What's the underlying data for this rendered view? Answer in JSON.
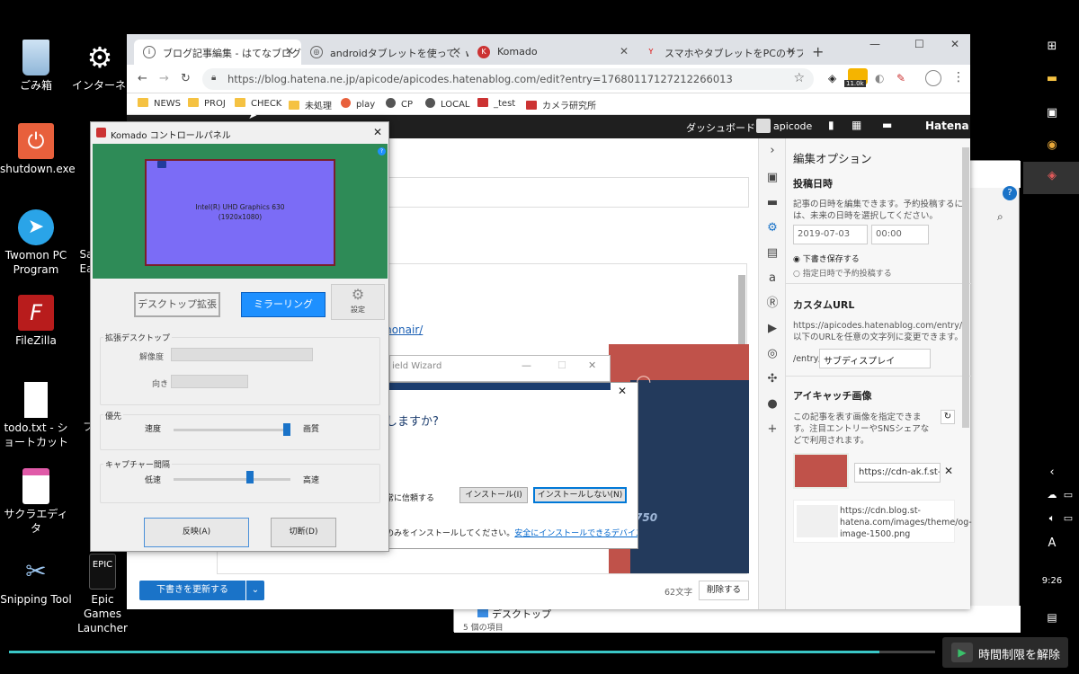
{
  "desktop": {
    "icons": [
      {
        "label": "ごみ箱",
        "name": "recycle-bin"
      },
      {
        "label": "インターネットショートカット",
        "name": "internet-shortcut"
      },
      {
        "label": "shutdown.exe",
        "name": "shutdown"
      },
      {
        "label": "Twomon PC Program",
        "name": "twomon"
      },
      {
        "label": "Sa Ea",
        "name": "sa"
      },
      {
        "label": "FileZilla",
        "name": "filezilla"
      },
      {
        "label": "todo.txt - ショートカット",
        "name": "todo"
      },
      {
        "label": "フ",
        "name": "fu"
      },
      {
        "label": "サクラエディタ",
        "name": "sakura"
      },
      {
        "label": "Snipping Tool",
        "name": "snipping"
      },
      {
        "label": "Epic Games Launcher",
        "name": "epic"
      }
    ]
  },
  "chrome": {
    "tabs": [
      {
        "title": "ブログ記事編集 - はてなブログ",
        "fav": "i"
      },
      {
        "title": "androidタブレットを使って、windows",
        "fav": "◎"
      },
      {
        "title": "Komado",
        "fav": "K"
      },
      {
        "title": "スマホやタブレットをPCのサブディスプレ",
        "fav": "Y"
      }
    ],
    "url": "https://blog.hatena.ne.jp/apicode/apicodes.hatenablog.com/edit?entry=17680117127212266013",
    "ext_badge": "11.0k",
    "bookmarks": [
      "NEWS",
      "PROJ",
      "CHECK",
      "未処理",
      "play",
      "CP",
      "LOCAL",
      "_test",
      "カメラ研究所"
    ]
  },
  "hatena": {
    "dashboard": "ダッシュボード",
    "user": "apicode",
    "brand": "Hatena",
    "link_text": "monair/",
    "update_button": "下書きを更新する",
    "char_count": "62文字",
    "delete_button": "削除する",
    "badge_750": "750"
  },
  "options": {
    "title": "編集オプション",
    "post_date_h": "投稿日時",
    "post_date_t": "記事の日時を編集できます。予約投稿するには、未来の日時を選択してください。",
    "date": "2019-07-03",
    "time": "00:00",
    "radio_draft": "下書き保存する",
    "radio_schedule": "指定日時で予約投稿する",
    "custom_url_h": "カスタムURL",
    "custom_url_t": "https://apicodes.hatenablog.com/entry/以下のURLを任意の文字列に変更できます。",
    "entry_prefix": "/entry/",
    "entry_value": "サブディスプレイ",
    "eyecatch_h": "アイキャッチ画像",
    "eyecatch_t": "この記事を表す画像を指定できます。注目エントリーやSNSシェアなどで利用されます。",
    "eyecatch_url": "https://cdn-ak.f.st-hat",
    "og_url": "https://cdn.blog.st-hatena.com/images/theme/og-image-1500.png"
  },
  "komado": {
    "title": "Komado コントロールパネル",
    "gpu_line1": "Intel(R) UHD Graphics 630",
    "gpu_line2": "(1920x1080)",
    "btn_extend": "デスクトップ拡張",
    "btn_mirror": "ミラーリング",
    "btn_settings": "設定",
    "grp_extend": "拡張デスクトップ",
    "resolution": "解像度",
    "orientation": "向き",
    "grp_priority": "優先",
    "speed": "速度",
    "quality": "画質",
    "grp_capture": "キャプチャー間隔",
    "slow": "低速",
    "fast": "高速",
    "btn_apply": "反映(A)",
    "btn_disconnect": "切断(D)"
  },
  "dialog": {
    "wizard_title": "ield Wizard",
    "question": "しますか?",
    "trust": "常に信頼する",
    "install": "インストール(I)",
    "dont_install": "インストールしない(N)",
    "footer": "のみをインストールしてください。",
    "footer_link": "安全にインストールできるデバイス ソフトウェ"
  },
  "explorer": {
    "folder": "デスクトップ",
    "items": "5 個の項目"
  },
  "taskbar": {
    "time": "9:26",
    "ime": "A"
  },
  "unlock": {
    "label": "時間制限を解除"
  },
  "colors": {
    "komado_green": "#2e8b57",
    "komado_screen": "#7b6cf6",
    "mirror_blue": "#1e90ff",
    "hatena_blue": "#1a73c8"
  }
}
